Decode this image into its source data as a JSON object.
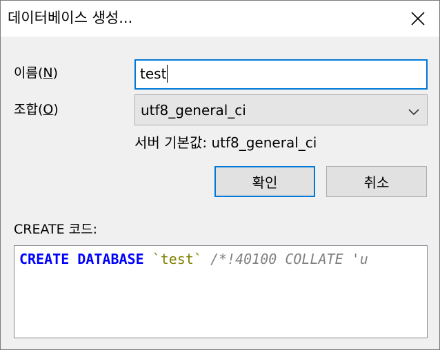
{
  "window": {
    "title": "데이터베이스 생성...",
    "close_icon": "close-icon"
  },
  "form": {
    "name_label_prefix": "이름(",
    "name_label_mnemonic": "N",
    "name_label_suffix": ")",
    "name_value": "test",
    "collation_label_prefix": "조합(",
    "collation_label_mnemonic": "O",
    "collation_label_suffix": ")",
    "collation_selected": "utf8_general_ci",
    "server_default": "서버 기본값: utf8_general_ci"
  },
  "buttons": {
    "ok_label": "확인",
    "cancel_label": "취소"
  },
  "code": {
    "label": "CREATE 코드:",
    "tokens": {
      "kw": "CREATE DATABASE",
      "space1": " ",
      "ident": "`test`",
      "space2": " ",
      "comment": "/*!40100 COLLATE 'u"
    }
  },
  "colors": {
    "accent": "#0078d7",
    "keyword": "#0000ff",
    "string": "#808000",
    "comment": "#808080"
  }
}
